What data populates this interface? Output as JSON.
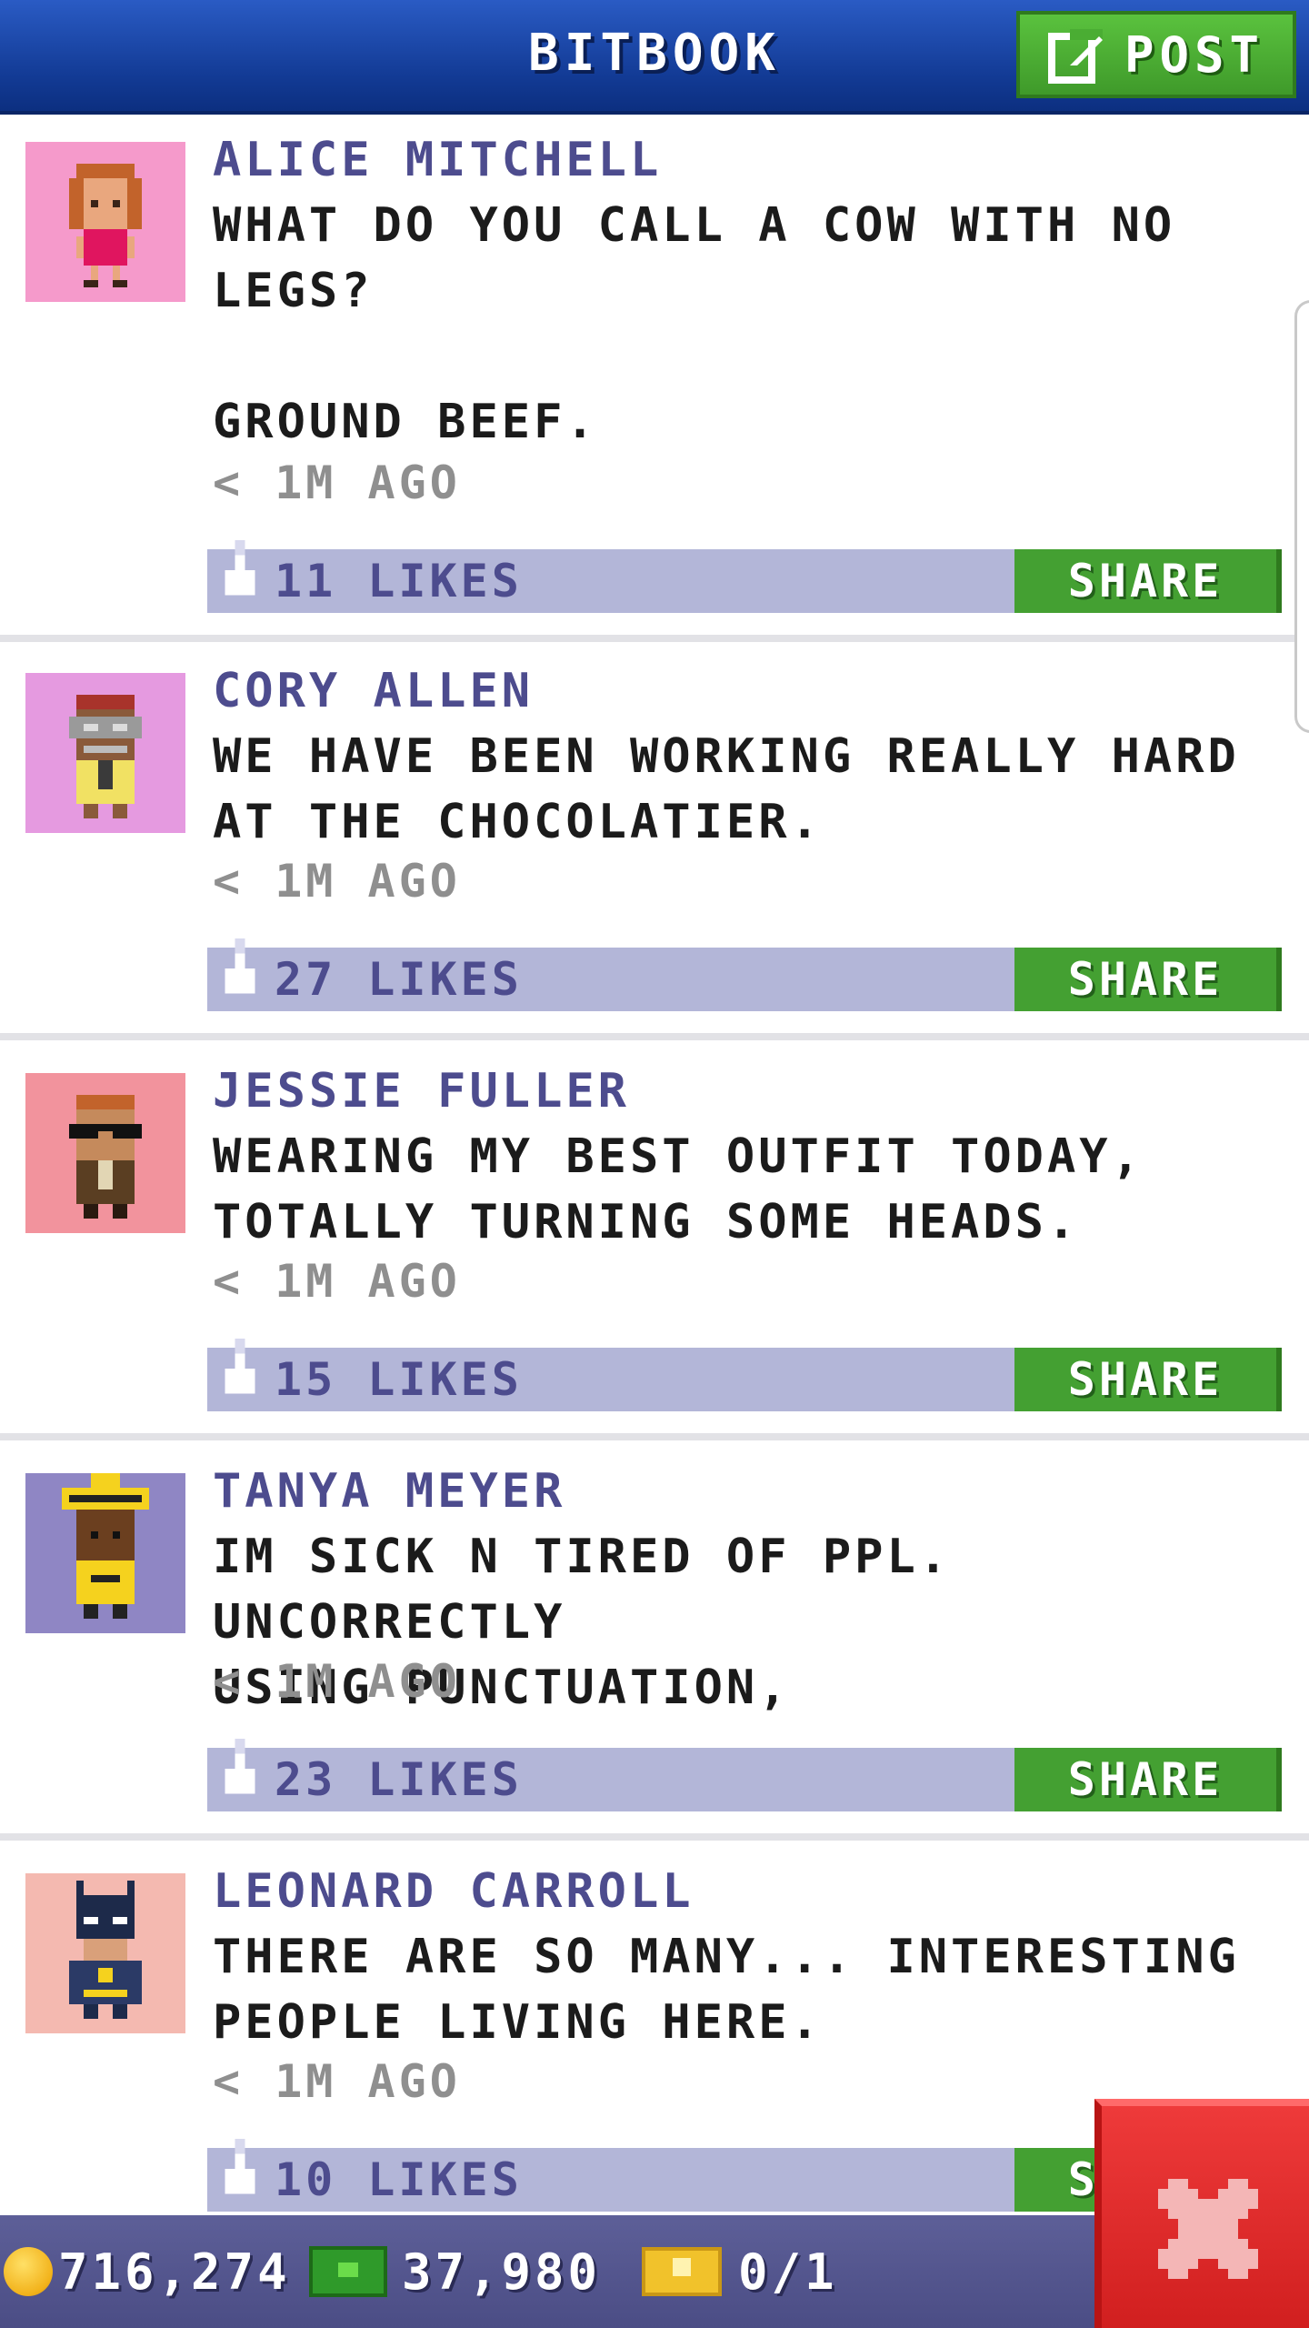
{
  "header": {
    "title": "BITBOOK",
    "post_label": "POST"
  },
  "posts": [
    {
      "author": "ALICE MITCHELL",
      "message": "WHAT DO YOU CALL A COW WITH NO\nLEGS?\n\nGROUND BEEF.",
      "time": "< 1M AGO",
      "likes": "11 LIKES",
      "share_label": "SHARE",
      "avatar_bg": "#f59acb"
    },
    {
      "author": "CORY ALLEN",
      "message": "WE HAVE BEEN WORKING REALLY HARD\nAT THE CHOCOLATIER.",
      "time": "< 1M AGO",
      "likes": "27 LIKES",
      "share_label": "SHARE",
      "avatar_bg": "#e59ae0"
    },
    {
      "author": "JESSIE FULLER",
      "message": "WEARING MY BEST OUTFIT TODAY,\nTOTALLY TURNING SOME HEADS.",
      "time": "< 1M AGO",
      "likes": "15 LIKES",
      "share_label": "SHARE",
      "avatar_bg": "#f2939d"
    },
    {
      "author": "TANYA MEYER",
      "message": "IM SICK N TIRED OF PPL. UNCORRECTLY\nUSING PUNCTUATION,",
      "time": "< 1M AGO",
      "likes": "23 LIKES",
      "share_label": "SHARE",
      "avatar_bg": "#8f86c4"
    },
    {
      "author": "LEONARD CARROLL",
      "message": "THERE ARE SO MANY... INTERESTING\nPEOPLE LIVING HERE.",
      "time": "< 1M AGO",
      "likes": "10 LIKES",
      "share_label": "SHARE",
      "avatar_bg": "#f4b9b0"
    }
  ],
  "footer": {
    "coins": "716,274",
    "bux": "37,980",
    "tickets": "0/1"
  },
  "colors": {
    "header": "#123a94",
    "accent_green": "#44a032",
    "like_bar": "#b3b6d8",
    "author": "#4d4c8e",
    "close": "#e02a2a"
  },
  "icons": {
    "post": "edit-icon",
    "like": "thumbs-up-icon",
    "close": "close-icon",
    "coin": "coin-icon",
    "bux": "bux-icon",
    "ticket": "ticket-icon"
  }
}
